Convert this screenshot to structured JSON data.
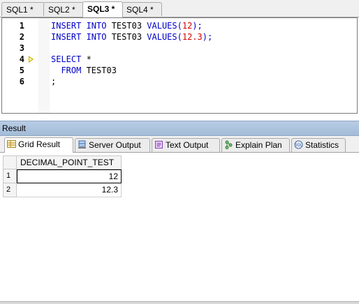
{
  "editor": {
    "tabs": [
      {
        "label": "SQL1 *"
      },
      {
        "label": "SQL2 *"
      },
      {
        "label": "SQL3 *"
      },
      {
        "label": "SQL4 *"
      }
    ],
    "lines": [
      {
        "num": "1",
        "tokens": [
          {
            "t": "INSERT INTO",
            "c": "kw"
          },
          {
            "t": " TEST03 ",
            "c": "id"
          },
          {
            "t": "VALUES",
            "c": "kw"
          },
          {
            "t": "(",
            "c": "kw"
          },
          {
            "t": "12",
            "c": "num"
          },
          {
            "t": ");",
            "c": "kw"
          }
        ]
      },
      {
        "num": "2",
        "tokens": [
          {
            "t": "INSERT INTO",
            "c": "kw"
          },
          {
            "t": " TEST03 ",
            "c": "id"
          },
          {
            "t": "VALUES",
            "c": "kw"
          },
          {
            "t": "(",
            "c": "kw"
          },
          {
            "t": "12.3",
            "c": "num"
          },
          {
            "t": ");",
            "c": "kw"
          }
        ]
      },
      {
        "num": "3",
        "tokens": []
      },
      {
        "num": "4",
        "tokens": [
          {
            "t": "SELECT",
            "c": "kw"
          },
          {
            "t": " *",
            "c": "id"
          }
        ]
      },
      {
        "num": "5",
        "tokens": [
          {
            "t": "  FROM",
            "c": "kw"
          },
          {
            "t": " TEST03",
            "c": "id"
          }
        ]
      },
      {
        "num": "6",
        "tokens": [
          {
            "t": ";",
            "c": "id"
          }
        ]
      }
    ]
  },
  "result_panel": {
    "title": "Result",
    "tabs": [
      {
        "label": "Grid Result",
        "icon": "grid-icon"
      },
      {
        "label": "Server Output",
        "icon": "server-output-icon"
      },
      {
        "label": "Text Output",
        "icon": "text-output-icon"
      },
      {
        "label": "Explain Plan",
        "icon": "explain-plan-icon"
      },
      {
        "label": "Statistics",
        "icon": "statistics-icon"
      }
    ],
    "grid": {
      "column": "DECIMAL_POINT_TEST",
      "rows": [
        {
          "num": "1",
          "value": "12"
        },
        {
          "num": "2",
          "value": "12.3"
        }
      ]
    }
  },
  "colors": {
    "keyword": "#0000c8",
    "number": "#d40000",
    "result_bar": "#b0c6e0"
  }
}
